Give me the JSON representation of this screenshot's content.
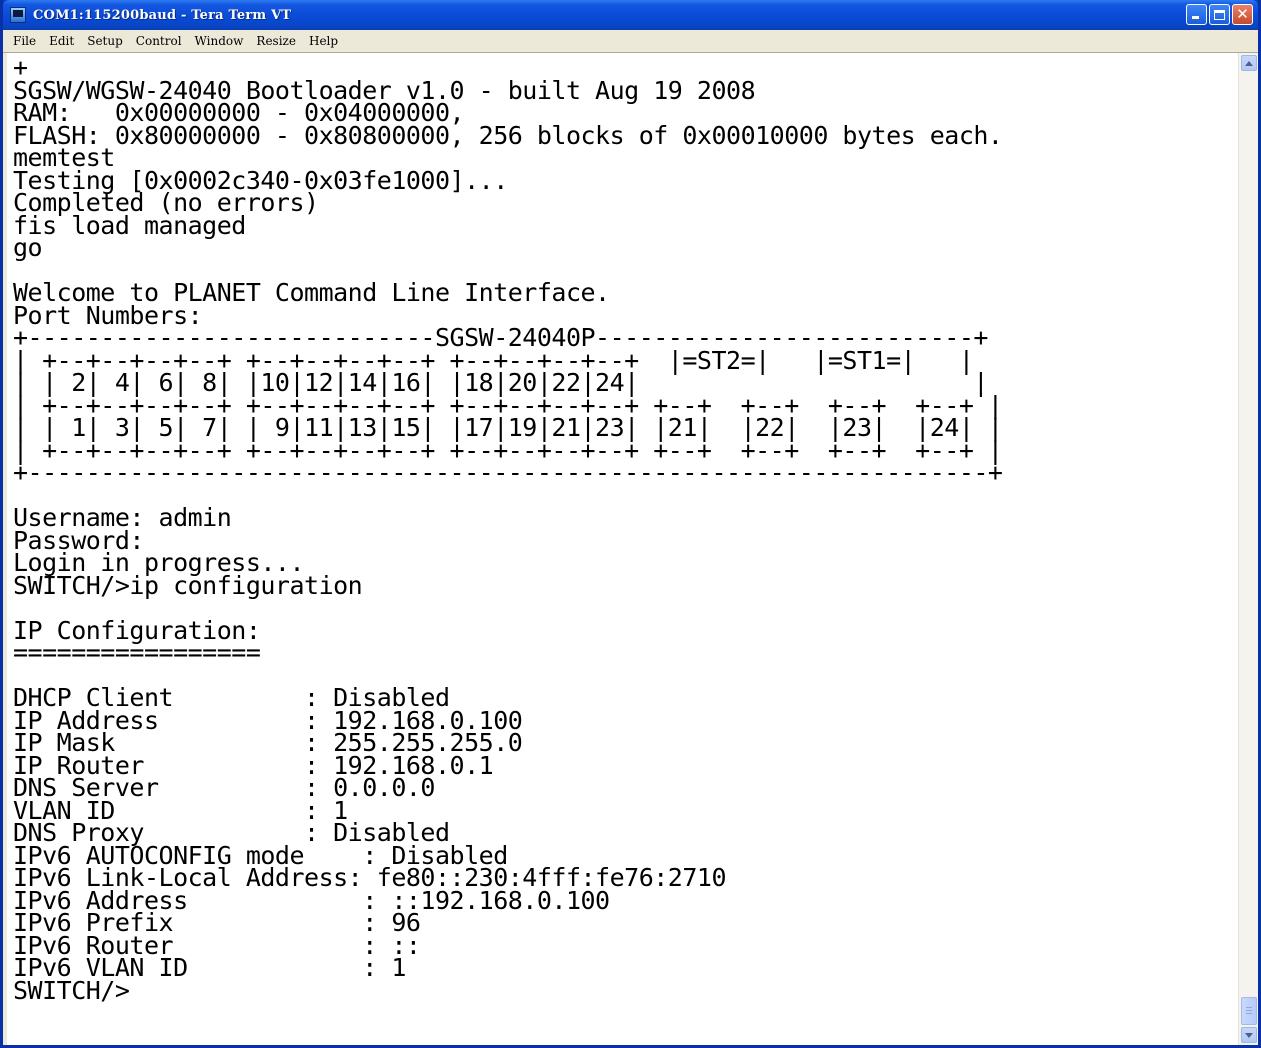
{
  "window": {
    "title": "COM1:115200baud - Tera Term VT",
    "icon": "tera-term-icon",
    "buttons": {
      "minimize": "minimize-icon",
      "maximize": "maximize-icon",
      "close": "close-icon"
    }
  },
  "menu": {
    "items": [
      "File",
      "Edit",
      "Setup",
      "Control",
      "Window",
      "Resize",
      "Help"
    ]
  },
  "terminal": {
    "lines": [
      "+",
      "SGSW/WGSW-24040 Bootloader v1.0 - built Aug 19 2008",
      "RAM:   0x00000000 - 0x04000000,",
      "FLASH: 0x80000000 - 0x80800000, 256 blocks of 0x00010000 bytes each.",
      "memtest",
      "Testing [0x0002c340-0x03fe1000]...",
      "Completed (no errors)",
      "fis load managed",
      "go",
      "",
      "Welcome to PLANET Command Line Interface.",
      "Port Numbers:",
      "+----------------------------SGSW-24040P--------------------------+",
      "| +--+--+--+--+ +--+--+--+--+ +--+--+--+--+  |=ST2=|   |=ST1=|   |",
      "| | 2| 4| 6| 8| |10|12|14|16| |18|20|22|24|                       |",
      "| +--+--+--+--+ +--+--+--+--+ +--+--+--+--+ +--+  +--+  +--+  +--+ |",
      "| | 1| 3| 5| 7| | 9|11|13|15| |17|19|21|23| |21|  |22|  |23|  |24| |",
      "| +--+--+--+--+ +--+--+--+--+ +--+--+--+--+ +--+  +--+  +--+  +--+ |",
      "+------------------------------------------------------------------+",
      "",
      "Username: admin",
      "Password:",
      "Login in progress...",
      "SWITCH/>ip configuration",
      "",
      "IP Configuration:",
      "=================",
      "",
      "DHCP Client         : Disabled",
      "IP Address          : 192.168.0.100",
      "IP Mask             : 255.255.255.0",
      "IP Router           : 192.168.0.1",
      "DNS Server          : 0.0.0.0",
      "VLAN ID             : 1",
      "DNS Proxy           : Disabled",
      "IPv6 AUTOCONFIG mode    : Disabled",
      "IPv6 Link-Local Address: fe80::230:4fff:fe76:2710",
      "IPv6 Address            : ::192.168.0.100",
      "IPv6 Prefix             : 96",
      "IPv6 Router             : ::",
      "IPv6 VLAN ID            : 1",
      "SWITCH/>"
    ]
  },
  "scrollbar": {
    "up": "scroll-up-arrow-icon",
    "down": "scroll-down-arrow-icon"
  },
  "colors": {
    "titlebar": "#0a4ad6",
    "terminal_bg": "#ffffff",
    "terminal_fg": "#000000",
    "chrome": "#ece9d8"
  }
}
